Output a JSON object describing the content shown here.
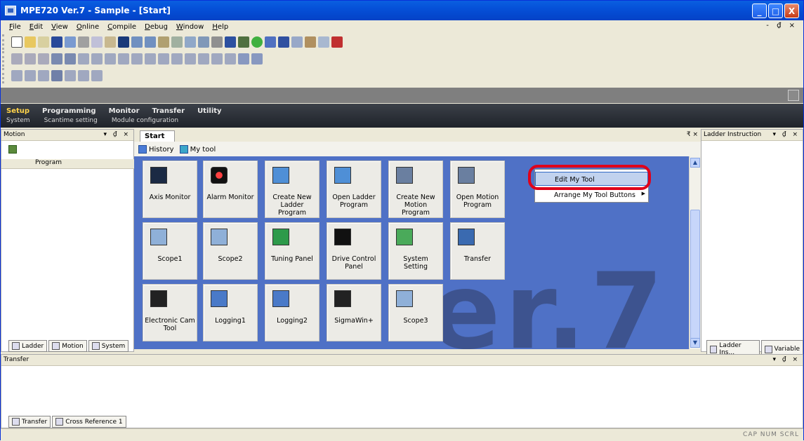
{
  "window": {
    "title": "MPE720 Ver.7 - Sample - [Start]"
  },
  "title_buttons": {
    "minimize": "_",
    "maximize": "□",
    "close": "X"
  },
  "menu": [
    "File",
    "Edit",
    "View",
    "Online",
    "Compile",
    "Debug",
    "Window",
    "Help"
  ],
  "mdi_controls": "- ₫ ×",
  "main_tabs": [
    {
      "label": "Setup",
      "active": true
    },
    {
      "label": "Programming"
    },
    {
      "label": "Monitor"
    },
    {
      "label": "Transfer"
    },
    {
      "label": "Utility"
    }
  ],
  "sub_tabs": [
    "System",
    "Scantime setting",
    "Module configuration"
  ],
  "left_panel": {
    "title": "Motion",
    "controls": "▾ ₫ ×",
    "tree_header": "Program",
    "bottom_tabs": [
      "Ladder",
      "Motion",
      "System"
    ]
  },
  "start": {
    "tab_label": "Start",
    "tab_controls": "₹ ×",
    "history_label": "History",
    "mytool_label": "My tool",
    "watermark": "er.7",
    "tiles": [
      {
        "label": "Axis Monitor",
        "icon": "axis-monitor-icon"
      },
      {
        "label": "Alarm Monitor",
        "icon": "alarm-monitor-icon"
      },
      {
        "label": "Create New Ladder Program",
        "icon": "create-ladder-icon"
      },
      {
        "label": "Open Ladder Program",
        "icon": "open-ladder-icon"
      },
      {
        "label": "Create New Motion Program",
        "icon": "create-motion-icon"
      },
      {
        "label": "Open Motion Program",
        "icon": "open-motion-icon"
      },
      {
        "label": "Scope1",
        "icon": "scope-icon"
      },
      {
        "label": "Scope2",
        "icon": "scope-icon"
      },
      {
        "label": "Tuning Panel",
        "icon": "tuning-panel-icon"
      },
      {
        "label": "Drive Control Panel",
        "icon": "drive-control-icon"
      },
      {
        "label": "System Setting",
        "icon": "system-setting-icon"
      },
      {
        "label": "Transfer",
        "icon": "transfer-icon"
      },
      {
        "label": "Electronic Cam Tool",
        "icon": "cam-tool-icon"
      },
      {
        "label": "Logging1",
        "icon": "logging-icon"
      },
      {
        "label": "Logging2",
        "icon": "logging-icon"
      },
      {
        "label": "SigmaWin+",
        "icon": "sigmawin-icon"
      },
      {
        "label": "Scope3",
        "icon": "scope-icon"
      }
    ]
  },
  "context_menu": {
    "items": [
      {
        "label": "Edit My Tool",
        "highlighted": true
      },
      {
        "label": "Arrange My Tool Buttons",
        "submenu": true
      }
    ]
  },
  "right_panel": {
    "title": "Ladder Instruction",
    "controls": "▾ ₫ ×",
    "bottom_tabs": [
      "Ladder Ins...",
      "Variable"
    ]
  },
  "bottom_panel": {
    "title": "Transfer",
    "controls": "▾ ₫ ×",
    "tabs": [
      "Transfer",
      "Cross Reference 1"
    ]
  },
  "status": "CAP NUM SCRL",
  "colors": {
    "canvas": "#4f71c6",
    "title_bar": "#0550d8",
    "highlight_ring": "#e0001a",
    "active_tab": "#ffd34a"
  }
}
